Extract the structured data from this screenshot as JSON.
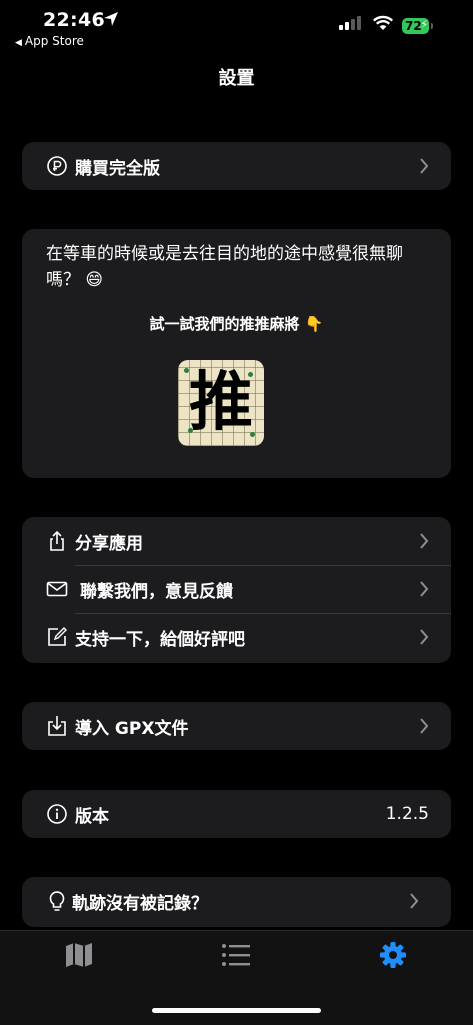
{
  "status": {
    "time": "22:46",
    "back_label": "App Store",
    "battery": "72"
  },
  "header": {
    "title": "設置"
  },
  "purchase": {
    "label": "購買完全版",
    "icon": "coin-icon"
  },
  "promo": {
    "text": "在等車的時候或是去往目的地的途中感覺很無聊嗎？ 😄",
    "cta": "試一試我們的推推麻將 👇",
    "icon_glyph": "推"
  },
  "actions": [
    {
      "label": "分享應用",
      "icon": "share-icon"
    },
    {
      "label": "聯繫我們，意見反饋",
      "icon": "mail-icon"
    },
    {
      "label": "支持一下，給個好評吧",
      "icon": "edit-icon"
    }
  ],
  "import": {
    "label": "導入 GPX文件",
    "icon": "import-icon"
  },
  "version": {
    "label": "版本",
    "value": "1.2.5",
    "icon": "info-icon"
  },
  "track_help": {
    "label": "軌跡沒有被記錄？",
    "icon": "lightbulb-icon"
  },
  "tabs": [
    {
      "name": "map",
      "icon": "map-icon",
      "active": false
    },
    {
      "name": "list",
      "icon": "list-icon",
      "active": false
    },
    {
      "name": "settings",
      "icon": "gear-icon",
      "active": true
    }
  ],
  "colors": {
    "accent": "#1f8fff",
    "card": "#1c1c1e",
    "battery": "#34c759"
  }
}
